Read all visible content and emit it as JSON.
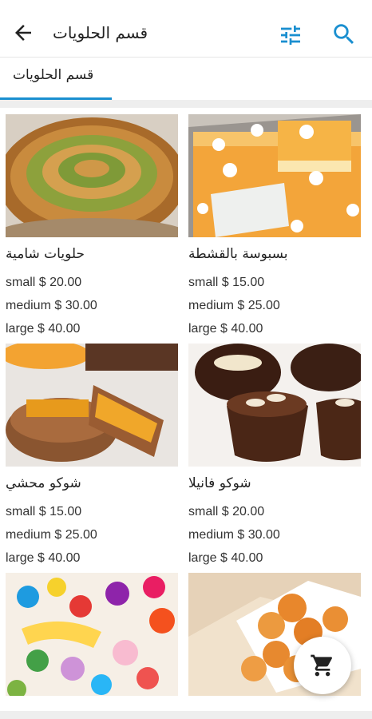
{
  "header": {
    "title": "قسم الحلويات",
    "back_icon": "arrow-left-icon",
    "filter_icon": "tune-icon",
    "search_icon": "search-icon"
  },
  "tabs": [
    {
      "label": "قسم الحلويات",
      "selected": true
    }
  ],
  "accent_color": "#1a8fd0",
  "products": [
    {
      "name": "بسبوسة بالقشطة",
      "image": "basbousa-image",
      "prices": [
        "small $ 15.00",
        "medium $ 25.00",
        "large $ 40.00"
      ]
    },
    {
      "name": "حلويات شامية",
      "image": "baklava-tray-image",
      "prices": [
        "small $ 20.00",
        "medium $ 30.00",
        "large $ 40.00"
      ]
    },
    {
      "name": "شوكو فانيلا",
      "image": "chocolate-cups-image",
      "prices": [
        "small $ 20.00",
        "medium $ 30.00",
        "large $ 40.00"
      ]
    },
    {
      "name": "شوكو محشي",
      "image": "filled-chocolate-image",
      "prices": [
        "small $ 15.00",
        "medium $ 25.00",
        "large $ 40.00"
      ]
    },
    {
      "name": "",
      "image": "sugar-balls-image",
      "prices": []
    },
    {
      "name": "",
      "image": "candy-image",
      "prices": []
    }
  ],
  "fab": {
    "icon": "cart-icon"
  }
}
